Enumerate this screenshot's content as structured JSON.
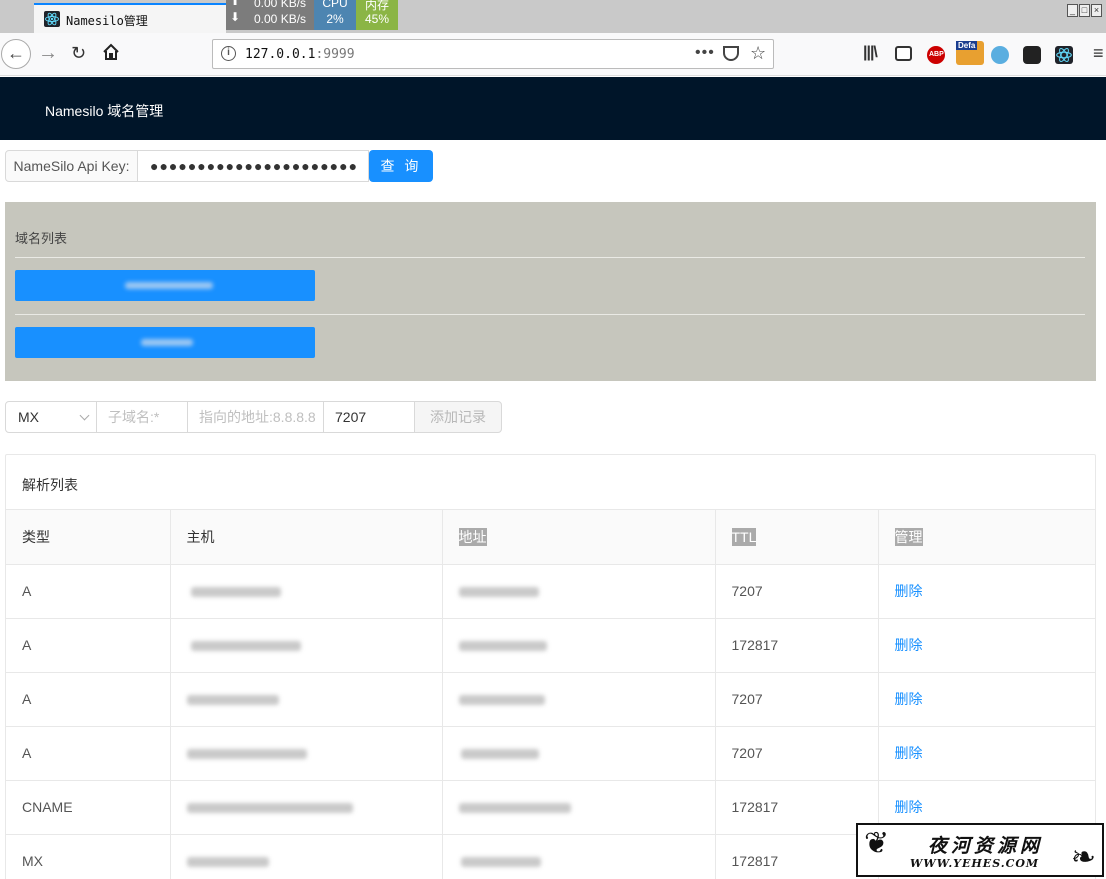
{
  "browser": {
    "tab_title": "Namesilo管理",
    "net_up": "0.00 KB/s",
    "net_down": "0.00 KB/s",
    "cpu_label": "CPU",
    "cpu_value": "2%",
    "mem_label": "内存",
    "mem_value": "45%",
    "url_host": "127.0.0.1",
    "url_port": ":9999",
    "url_more": "•••",
    "ext_abp": "ABP",
    "ext_default": "Defa"
  },
  "app": {
    "title": "Namesilo 域名管理"
  },
  "api": {
    "label": "NameSilo Api Key:",
    "value": "●●●●●●●●●●●●●●●●●●●●●●",
    "query_label": "查 询"
  },
  "domains": {
    "title": "域名列表",
    "items": [
      {
        "label": ""
      },
      {
        "label": ""
      }
    ]
  },
  "add_record": {
    "type_value": "MX",
    "host_placeholder": "子域名:*",
    "address_placeholder": "指向的地址:8.8.8.8",
    "ttl_value": "7207",
    "submit_label": "添加记录"
  },
  "records": {
    "title": "解析列表",
    "columns": [
      "类型",
      "主机",
      "地址",
      "TTL",
      "管理"
    ],
    "rows": [
      {
        "type": "A",
        "ttl": "7207",
        "action": "删除"
      },
      {
        "type": "A",
        "ttl": "172817",
        "action": "删除"
      },
      {
        "type": "A",
        "ttl": "7207",
        "action": "删除"
      },
      {
        "type": "A",
        "ttl": "7207",
        "action": "删除"
      },
      {
        "type": "CNAME",
        "ttl": "172817",
        "action": "删除"
      },
      {
        "type": "MX",
        "ttl": "172817",
        "action": "删除"
      }
    ]
  },
  "watermark": {
    "cn": "夜河资源网",
    "en": "WWW.YEHES.COM"
  },
  "colors": {
    "header_bg": "#001529",
    "primary": "#1890ff",
    "domain_card_bg": "#c6c6bd",
    "cpu_bg": "#4d85b1",
    "mem_bg": "#8bb545"
  }
}
